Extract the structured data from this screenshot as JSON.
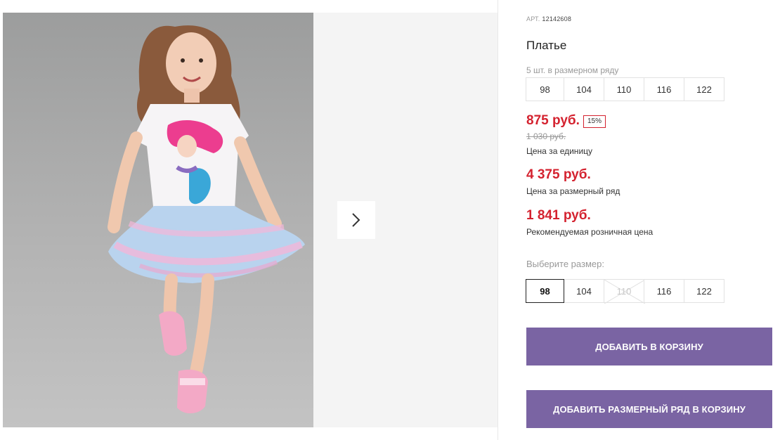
{
  "product": {
    "art_label": "АРТ.",
    "art_number": "12142608",
    "title": "Платье"
  },
  "pack": {
    "label": "5 шт. в размерном ряду",
    "sizes": [
      "98",
      "104",
      "110",
      "116",
      "122"
    ]
  },
  "prices": {
    "unit_price": "875 руб.",
    "discount": "15%",
    "old_price": "1 030 руб.",
    "unit_label": "Цена за единицу",
    "pack_price": "4 375 руб.",
    "pack_label": "Цена за размерный ряд",
    "retail_price": "1 841 руб.",
    "retail_label": "Рекомендуемая розничная цена"
  },
  "size_select": {
    "label": "Выберите размер:",
    "sizes": [
      "98",
      "104",
      "110",
      "116",
      "122"
    ],
    "selected": "98",
    "unavailable": [
      "110"
    ]
  },
  "buttons": {
    "add_to_cart": "ДОБАВИТЬ В КОРЗИНУ",
    "add_pack_to_cart": "ДОБАВИТЬ РАЗМЕРНЫЙ РЯД В КОРЗИНУ"
  },
  "colors": {
    "accent_price": "#d4222f",
    "button": "#7a64a3"
  },
  "icons": {
    "next": "chevron-right-icon"
  }
}
